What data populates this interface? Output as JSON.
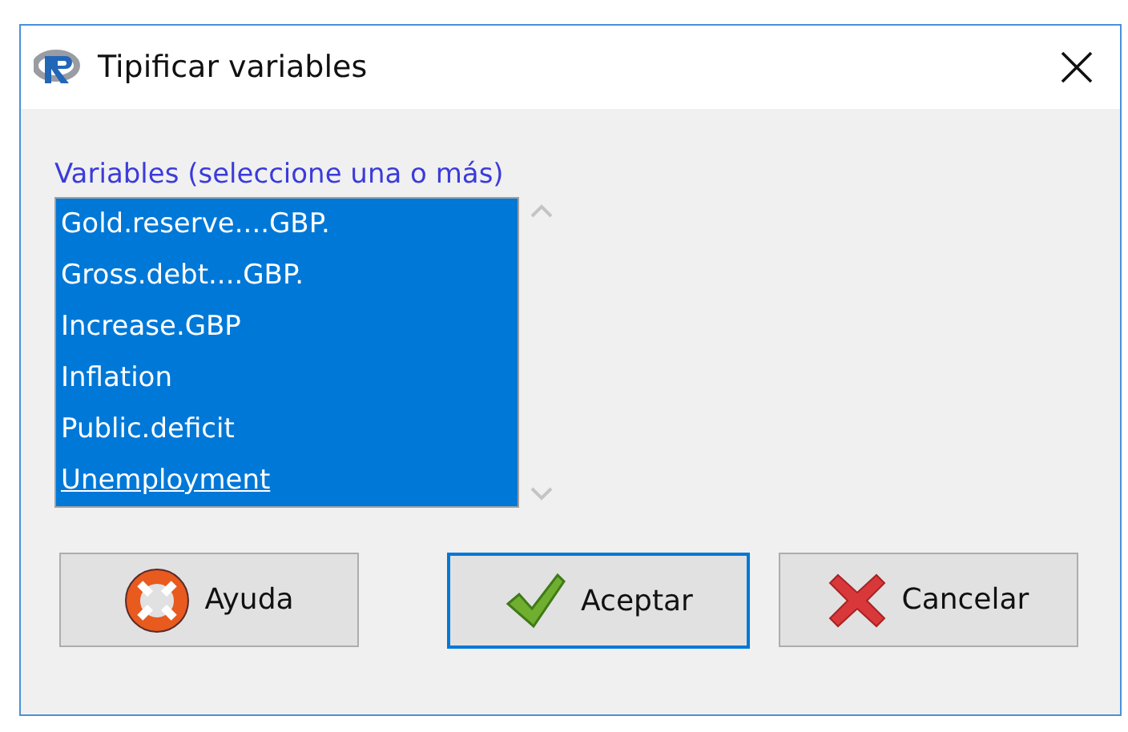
{
  "window": {
    "title": "Tipificar variables"
  },
  "variables": {
    "label": "Variables (seleccione una o más)",
    "items": [
      {
        "name": "Gold.reserve....GBP.",
        "selected": true,
        "focused": false
      },
      {
        "name": "Gross.debt....GBP.",
        "selected": true,
        "focused": false
      },
      {
        "name": "Increase.GBP",
        "selected": true,
        "focused": false
      },
      {
        "name": "Inflation",
        "selected": true,
        "focused": false
      },
      {
        "name": "Public.deficit",
        "selected": true,
        "focused": false
      },
      {
        "name": "Unemployment",
        "selected": true,
        "focused": true
      }
    ]
  },
  "buttons": [
    {
      "label": "Ayuda",
      "kind": "help",
      "focused": false
    },
    {
      "label": "Aceptar",
      "kind": "ok",
      "focused": true
    },
    {
      "label": "Cancelar",
      "kind": "cancel",
      "focused": false
    }
  ]
}
